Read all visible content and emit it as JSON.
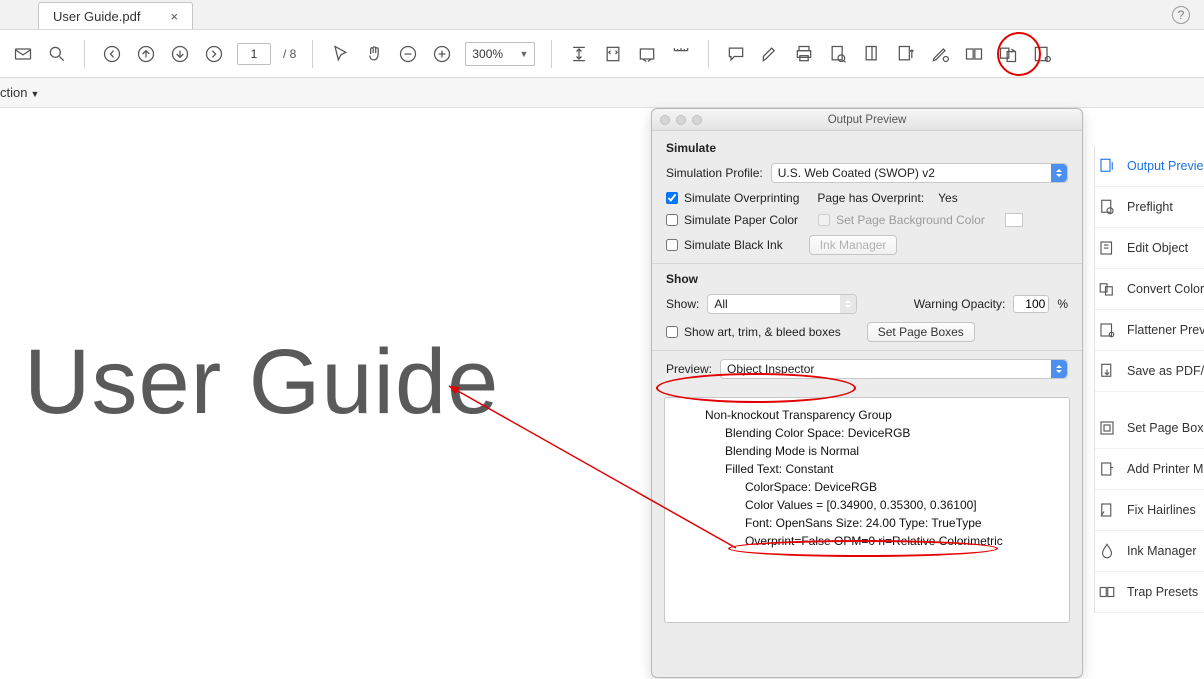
{
  "tab": {
    "file_name": "User Guide.pdf"
  },
  "page": {
    "current": "1",
    "total": "8"
  },
  "zoom": {
    "value": "300%"
  },
  "action_menu": {
    "label": "ction"
  },
  "document": {
    "title_text": "User Guide"
  },
  "panel": {
    "title": "Output Preview",
    "simulate_label": "Simulate",
    "sim_profile_label": "Simulation Profile:",
    "sim_profile_value": "U.S. Web Coated (SWOP) v2",
    "sim_over_label": "Simulate Overprinting",
    "page_over_label": "Page has Overprint:",
    "page_over_value": "Yes",
    "sim_paper_label": "Simulate Paper Color",
    "set_bg_label": "Set Page Background Color",
    "sim_black_label": "Simulate Black Ink",
    "ink_mgr_btn": "Ink Manager",
    "show_section": "Show",
    "show_label": "Show:",
    "show_value": "All",
    "warn_label": "Warning Opacity:",
    "warn_value": "100",
    "warn_pct": "%",
    "show_boxes_label": "Show art, trim, & bleed boxes",
    "set_boxes_btn": "Set Page Boxes",
    "preview_label": "Preview:",
    "preview_value": "Object Inspector",
    "inspector": {
      "l1": "Non-knockout Transparency Group",
      "l2": "Blending Color Space: DeviceRGB",
      "l3": "Blending Mode is Normal",
      "l4": "Filled Text: Constant",
      "l5": "ColorSpace: DeviceRGB",
      "l6": "Color Values = [0.34900, 0.35300, 0.36100]",
      "l7": "Font: OpenSans Size: 24.00 Type: TrueType",
      "l8": "Overprint=False OPM=0 ri=Relative Colorimetric"
    }
  },
  "right": {
    "output_preview": "Output Previe",
    "preflight": "Preflight",
    "edit_object": "Edit Object",
    "convert_colors": "Convert Color",
    "flattener": "Flattener Prev",
    "save_as": "Save as PDF/",
    "set_page_box": "Set Page Box",
    "add_printer": "Add Printer M",
    "fix_hairlines": "Fix Hairlines",
    "ink_manager": "Ink Manager",
    "trap_presets": "Trap Presets"
  }
}
